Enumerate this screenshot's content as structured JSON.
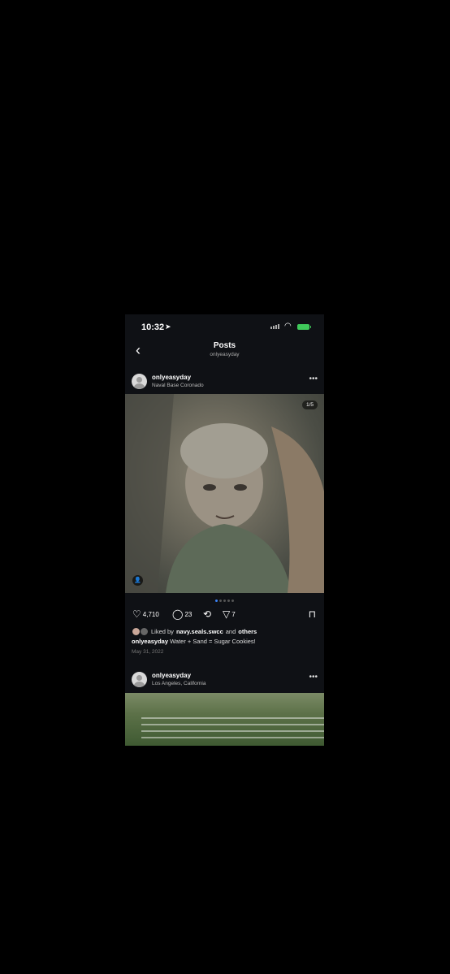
{
  "status": {
    "time": "10:32"
  },
  "nav": {
    "title": "Posts",
    "subtitle": "onlyeasyday"
  },
  "post1": {
    "username": "onlyeasyday",
    "location": "Naval Base Coronado",
    "image_counter": "1/5",
    "likes": "4,710",
    "comments": "23",
    "shares": "7",
    "liked_by_prefix": "Liked by",
    "liked_by_user": "navy.seals.swcc",
    "liked_by_and": "and",
    "liked_by_others": "others",
    "caption_user": "onlyeasyday",
    "caption_text": "Water + Sand = Sugar Cookies!",
    "date": "May 31, 2022"
  },
  "post2": {
    "username": "onlyeasyday",
    "location": "Los Angeles, California"
  },
  "colors": {
    "background": "#000000",
    "feed_bg": "#0f1115",
    "accent": "#3b82f6"
  }
}
